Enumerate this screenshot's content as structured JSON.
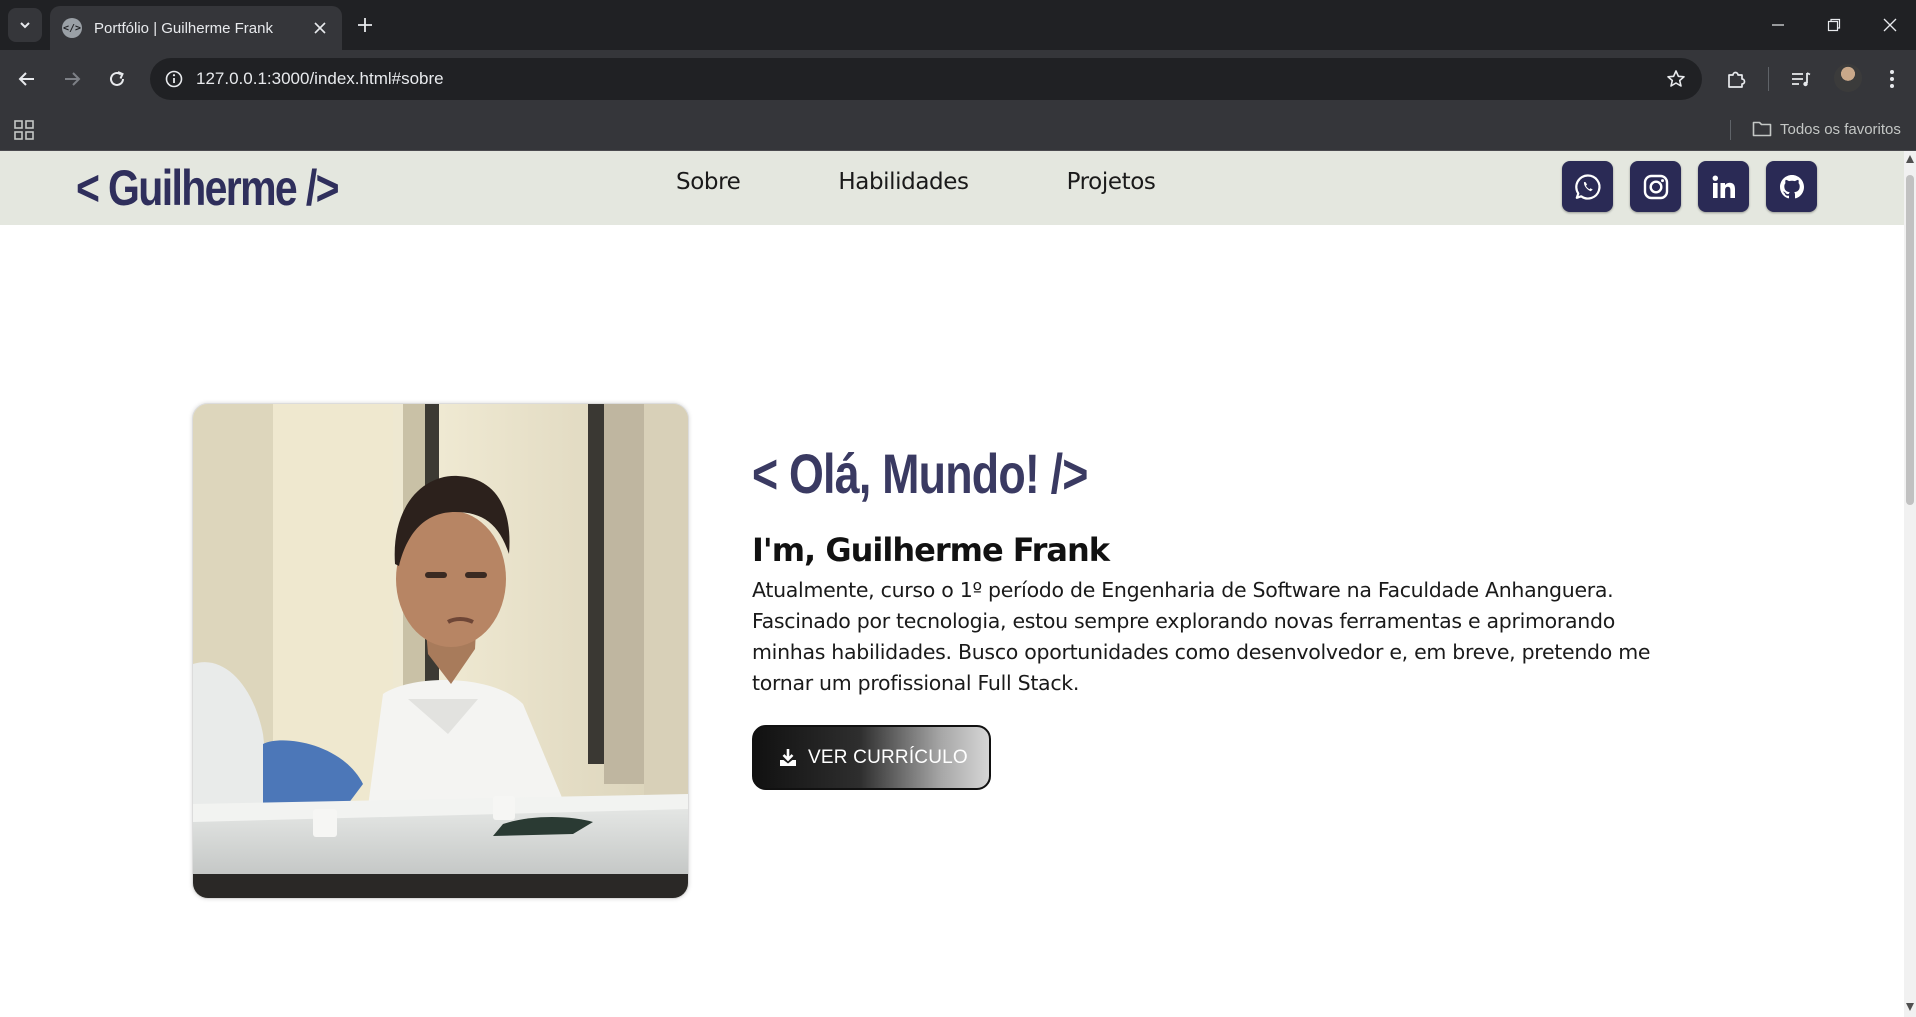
{
  "browser": {
    "tab_title": "Portfólio | Guilherme Frank",
    "url": "127.0.0.1:3000/index.html#sobre",
    "bookmarks_all_label": "Todos os favoritos"
  },
  "site": {
    "logo": "< Guilherme />",
    "nav": [
      {
        "label": "Sobre"
      },
      {
        "label": "Habilidades"
      },
      {
        "label": "Projetos"
      }
    ],
    "socials": [
      {
        "icon": "whatsapp-icon"
      },
      {
        "icon": "instagram-icon"
      },
      {
        "icon": "linkedin-icon"
      },
      {
        "icon": "github-icon"
      }
    ],
    "colors": {
      "header_bg": "#e4e7df",
      "brand": "#2f2f5c",
      "social_bg": "#2a2a55"
    }
  },
  "hero": {
    "greeting": "< Olá, Mundo! />",
    "name": "I'm, Guilherme Frank",
    "description": "Atualmente, curso o 1º período de Engenharia de Software na Faculdade Anhanguera. Fascinado por tecnologia, estou sempre explorando novas ferramentas e aprimorando minhas habilidades. Busco oportunidades como desenvolvedor e, em breve, pretendo me tornar um profissional Full Stack.",
    "cv_button": "VER CURRÍCULO"
  }
}
